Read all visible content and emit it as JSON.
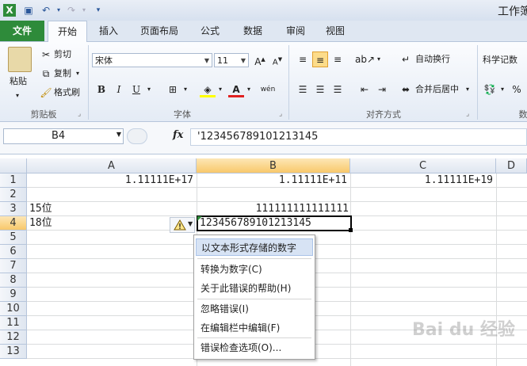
{
  "window": {
    "title": "工作簿"
  },
  "tabs": [
    "文件",
    "开始",
    "插入",
    "页面布局",
    "公式",
    "数据",
    "审阅",
    "视图"
  ],
  "ribbon": {
    "clipboard": {
      "paste": "粘贴",
      "cut": "剪切",
      "copy": "复制",
      "format_painter": "格式刷",
      "label": "剪贴板"
    },
    "font": {
      "name": "宋体",
      "size": "11",
      "bold": "B",
      "italic": "I",
      "underline": "U",
      "label": "字体"
    },
    "alignment": {
      "wrap": "自动换行",
      "merge": "合并后居中",
      "label": "对齐方式"
    },
    "number": {
      "format": "科学记数",
      "percent": "%",
      "label": "数"
    }
  },
  "formula_bar": {
    "name_box": "B4",
    "fx": "fx",
    "formula": "'123456789101213145"
  },
  "sheet": {
    "columns": [
      "A",
      "B",
      "C",
      "D"
    ],
    "rows": [
      "1",
      "2",
      "3",
      "4",
      "5",
      "6",
      "7",
      "8",
      "9",
      "10",
      "11",
      "12",
      "13"
    ],
    "cells": {
      "A1": "1.11111E+17",
      "B1": "1.11111E+11",
      "C1": "1.11111E+19",
      "A3": "15位",
      "B3": "111111111111111",
      "A4": "18位",
      "B4": "123456789101213145"
    }
  },
  "error_menu": {
    "items": [
      "以文本形式存储的数字",
      "转换为数字(C)",
      "关于此错误的帮助(H)",
      "忽略错误(I)",
      "在编辑栏中编辑(F)",
      "错误检查选项(O)..."
    ]
  },
  "watermark": "Bai du 经验"
}
